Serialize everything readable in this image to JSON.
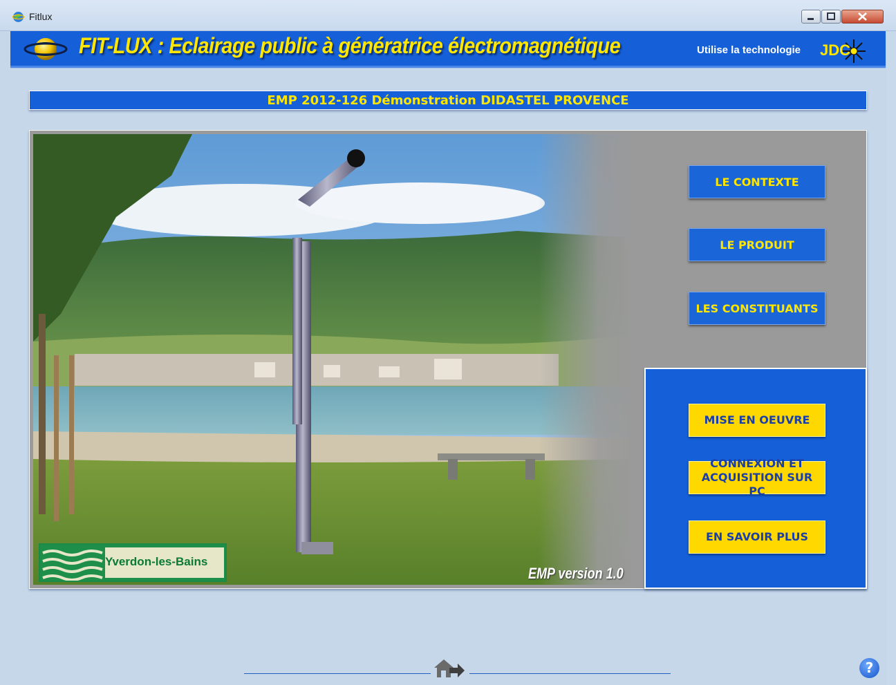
{
  "window": {
    "title": "Fitlux"
  },
  "header": {
    "title": "FIT-LUX : Eclairage public à génératrice électromagnétique",
    "tech_label": "Utilise la technologie",
    "tech_logo_text": "JDC"
  },
  "banner": {
    "text": "EMP 2012-126 Démonstration DIDASTEL PROVENCE"
  },
  "photo": {
    "town_label": "Yverdon-les-Bains",
    "version_label": "EMP version 1.0"
  },
  "menu": {
    "primary": [
      {
        "label": "LE CONTEXTE"
      },
      {
        "label": "LE PRODUIT"
      },
      {
        "label": "LES CONSTITUANTS"
      }
    ],
    "secondary": [
      {
        "label": "MISE EN OEUVRE"
      },
      {
        "label": "CONNEXION ET ACQUISITION SUR PC"
      },
      {
        "label": "EN SAVOIR PLUS"
      }
    ]
  },
  "footer": {
    "help_symbol": "?"
  },
  "colors": {
    "brand_blue": "#1560d8",
    "accent_yellow": "#ffe600",
    "button_yellow": "#ffd800",
    "panel_gray": "#9a9a9a"
  }
}
